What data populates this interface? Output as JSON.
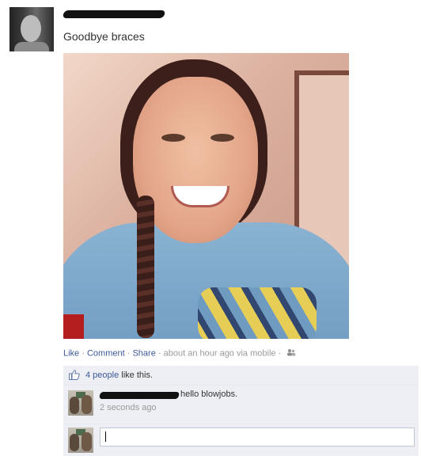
{
  "post": {
    "status_text": "Goodbye braces"
  },
  "actions": {
    "like": "Like",
    "comment": "Comment",
    "share": "Share",
    "separator": "·",
    "meta": "about an hour ago via mobile",
    "audience_icon": "friends-icon"
  },
  "likes": {
    "icon": "thumbs-up-icon",
    "people_link": "4 people",
    "suffix": "like this."
  },
  "comment": {
    "text": "hello blowjobs.",
    "time": "2 seconds ago"
  },
  "colors": {
    "link": "#3b5998",
    "ufi_bg": "#edeff4",
    "meta_gray": "#999999"
  }
}
